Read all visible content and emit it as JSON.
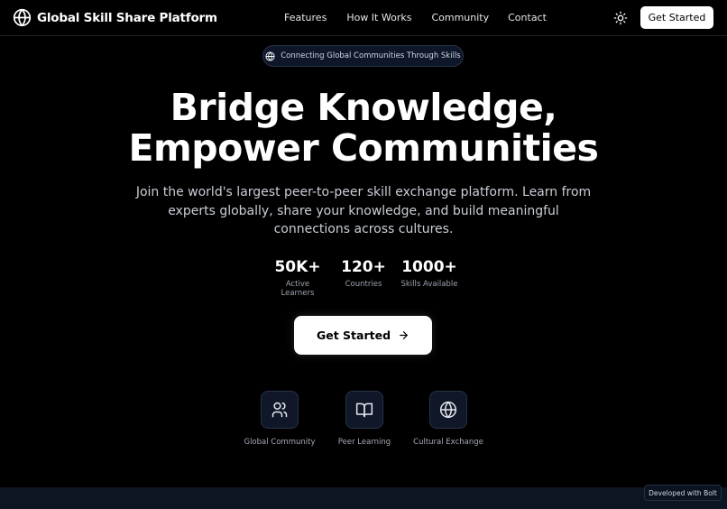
{
  "brand": {
    "name": "Global Skill Share Platform",
    "icon": "globe-icon"
  },
  "nav": {
    "links": [
      "Features",
      "How It Works",
      "Community",
      "Contact"
    ],
    "theme_icon": "sun-icon",
    "cta_label": "Get Started"
  },
  "hero": {
    "badge": {
      "icon": "globe-icon",
      "text": "Connecting Global Communities Through Skills"
    },
    "headline_line1": "Bridge Knowledge,",
    "headline_line2": "Empower Communities",
    "subtitle": "Join the world's largest peer-to-peer skill exchange platform. Learn from experts globally, share your knowledge, and build meaningful connections across cultures.",
    "stats": [
      {
        "value": "50K+",
        "label": "Active Learners"
      },
      {
        "value": "120+",
        "label": "Countries"
      },
      {
        "value": "1000+",
        "label": "Skills Available"
      }
    ],
    "cta": {
      "label": "Get Started",
      "icon": "arrow-right-icon"
    },
    "features": [
      {
        "icon": "users-icon",
        "label": "Global Community"
      },
      {
        "icon": "book-open-icon",
        "label": "Peer Learning"
      },
      {
        "icon": "globe-icon",
        "label": "Cultural Exchange"
      }
    ]
  },
  "footer": {
    "bolt_badge": "Developed with Bolt"
  },
  "colors": {
    "background": "#000000",
    "text": "#ffffff",
    "muted_text": "#9ca3af",
    "badge_bg": "#0e1629",
    "card_border": "#283246",
    "button_bg": "#ffffff",
    "button_text": "#000000"
  }
}
